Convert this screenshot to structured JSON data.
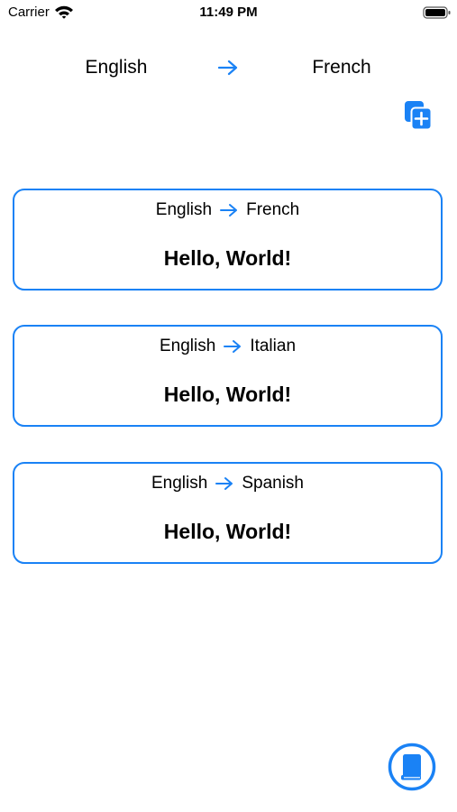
{
  "status_bar": {
    "carrier": "Carrier",
    "time": "11:49 PM"
  },
  "language_selector": {
    "source": "English",
    "target": "French"
  },
  "accent_color": "#1a82f5",
  "translations": [
    {
      "source": "English",
      "target": "French",
      "text": "Hello, World!"
    },
    {
      "source": "English",
      "target": "Italian",
      "text": "Hello, World!"
    },
    {
      "source": "English",
      "target": "Spanish",
      "text": "Hello, World!"
    }
  ],
  "icons": {
    "add": "add-translation-icon",
    "bottom": "book-icon"
  }
}
